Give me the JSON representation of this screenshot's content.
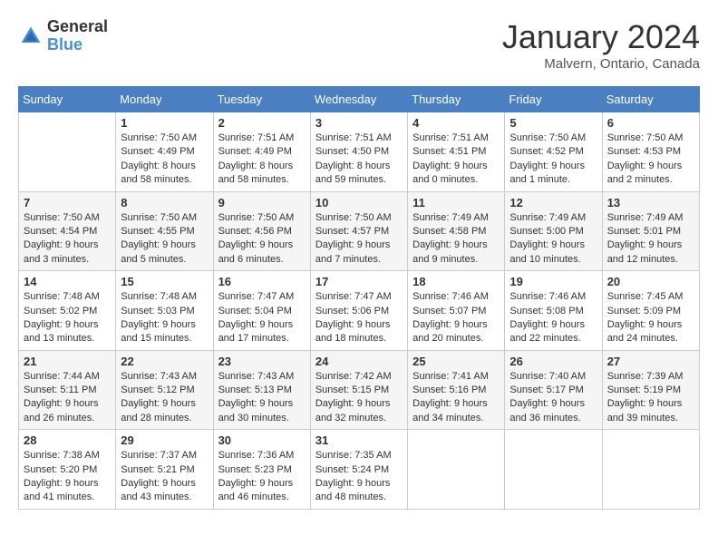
{
  "logo": {
    "general": "General",
    "blue": "Blue"
  },
  "title": "January 2024",
  "location": "Malvern, Ontario, Canada",
  "weekdays": [
    "Sunday",
    "Monday",
    "Tuesday",
    "Wednesday",
    "Thursday",
    "Friday",
    "Saturday"
  ],
  "weeks": [
    [
      {
        "day": "",
        "sunrise": "",
        "sunset": "",
        "daylight": ""
      },
      {
        "day": "1",
        "sunrise": "Sunrise: 7:50 AM",
        "sunset": "Sunset: 4:49 PM",
        "daylight": "Daylight: 8 hours and 58 minutes."
      },
      {
        "day": "2",
        "sunrise": "Sunrise: 7:51 AM",
        "sunset": "Sunset: 4:49 PM",
        "daylight": "Daylight: 8 hours and 58 minutes."
      },
      {
        "day": "3",
        "sunrise": "Sunrise: 7:51 AM",
        "sunset": "Sunset: 4:50 PM",
        "daylight": "Daylight: 8 hours and 59 minutes."
      },
      {
        "day": "4",
        "sunrise": "Sunrise: 7:51 AM",
        "sunset": "Sunset: 4:51 PM",
        "daylight": "Daylight: 9 hours and 0 minutes."
      },
      {
        "day": "5",
        "sunrise": "Sunrise: 7:50 AM",
        "sunset": "Sunset: 4:52 PM",
        "daylight": "Daylight: 9 hours and 1 minute."
      },
      {
        "day": "6",
        "sunrise": "Sunrise: 7:50 AM",
        "sunset": "Sunset: 4:53 PM",
        "daylight": "Daylight: 9 hours and 2 minutes."
      }
    ],
    [
      {
        "day": "7",
        "sunrise": "Sunrise: 7:50 AM",
        "sunset": "Sunset: 4:54 PM",
        "daylight": "Daylight: 9 hours and 3 minutes."
      },
      {
        "day": "8",
        "sunrise": "Sunrise: 7:50 AM",
        "sunset": "Sunset: 4:55 PM",
        "daylight": "Daylight: 9 hours and 5 minutes."
      },
      {
        "day": "9",
        "sunrise": "Sunrise: 7:50 AM",
        "sunset": "Sunset: 4:56 PM",
        "daylight": "Daylight: 9 hours and 6 minutes."
      },
      {
        "day": "10",
        "sunrise": "Sunrise: 7:50 AM",
        "sunset": "Sunset: 4:57 PM",
        "daylight": "Daylight: 9 hours and 7 minutes."
      },
      {
        "day": "11",
        "sunrise": "Sunrise: 7:49 AM",
        "sunset": "Sunset: 4:58 PM",
        "daylight": "Daylight: 9 hours and 9 minutes."
      },
      {
        "day": "12",
        "sunrise": "Sunrise: 7:49 AM",
        "sunset": "Sunset: 5:00 PM",
        "daylight": "Daylight: 9 hours and 10 minutes."
      },
      {
        "day": "13",
        "sunrise": "Sunrise: 7:49 AM",
        "sunset": "Sunset: 5:01 PM",
        "daylight": "Daylight: 9 hours and 12 minutes."
      }
    ],
    [
      {
        "day": "14",
        "sunrise": "Sunrise: 7:48 AM",
        "sunset": "Sunset: 5:02 PM",
        "daylight": "Daylight: 9 hours and 13 minutes."
      },
      {
        "day": "15",
        "sunrise": "Sunrise: 7:48 AM",
        "sunset": "Sunset: 5:03 PM",
        "daylight": "Daylight: 9 hours and 15 minutes."
      },
      {
        "day": "16",
        "sunrise": "Sunrise: 7:47 AM",
        "sunset": "Sunset: 5:04 PM",
        "daylight": "Daylight: 9 hours and 17 minutes."
      },
      {
        "day": "17",
        "sunrise": "Sunrise: 7:47 AM",
        "sunset": "Sunset: 5:06 PM",
        "daylight": "Daylight: 9 hours and 18 minutes."
      },
      {
        "day": "18",
        "sunrise": "Sunrise: 7:46 AM",
        "sunset": "Sunset: 5:07 PM",
        "daylight": "Daylight: 9 hours and 20 minutes."
      },
      {
        "day": "19",
        "sunrise": "Sunrise: 7:46 AM",
        "sunset": "Sunset: 5:08 PM",
        "daylight": "Daylight: 9 hours and 22 minutes."
      },
      {
        "day": "20",
        "sunrise": "Sunrise: 7:45 AM",
        "sunset": "Sunset: 5:09 PM",
        "daylight": "Daylight: 9 hours and 24 minutes."
      }
    ],
    [
      {
        "day": "21",
        "sunrise": "Sunrise: 7:44 AM",
        "sunset": "Sunset: 5:11 PM",
        "daylight": "Daylight: 9 hours and 26 minutes."
      },
      {
        "day": "22",
        "sunrise": "Sunrise: 7:43 AM",
        "sunset": "Sunset: 5:12 PM",
        "daylight": "Daylight: 9 hours and 28 minutes."
      },
      {
        "day": "23",
        "sunrise": "Sunrise: 7:43 AM",
        "sunset": "Sunset: 5:13 PM",
        "daylight": "Daylight: 9 hours and 30 minutes."
      },
      {
        "day": "24",
        "sunrise": "Sunrise: 7:42 AM",
        "sunset": "Sunset: 5:15 PM",
        "daylight": "Daylight: 9 hours and 32 minutes."
      },
      {
        "day": "25",
        "sunrise": "Sunrise: 7:41 AM",
        "sunset": "Sunset: 5:16 PM",
        "daylight": "Daylight: 9 hours and 34 minutes."
      },
      {
        "day": "26",
        "sunrise": "Sunrise: 7:40 AM",
        "sunset": "Sunset: 5:17 PM",
        "daylight": "Daylight: 9 hours and 36 minutes."
      },
      {
        "day": "27",
        "sunrise": "Sunrise: 7:39 AM",
        "sunset": "Sunset: 5:19 PM",
        "daylight": "Daylight: 9 hours and 39 minutes."
      }
    ],
    [
      {
        "day": "28",
        "sunrise": "Sunrise: 7:38 AM",
        "sunset": "Sunset: 5:20 PM",
        "daylight": "Daylight: 9 hours and 41 minutes."
      },
      {
        "day": "29",
        "sunrise": "Sunrise: 7:37 AM",
        "sunset": "Sunset: 5:21 PM",
        "daylight": "Daylight: 9 hours and 43 minutes."
      },
      {
        "day": "30",
        "sunrise": "Sunrise: 7:36 AM",
        "sunset": "Sunset: 5:23 PM",
        "daylight": "Daylight: 9 hours and 46 minutes."
      },
      {
        "day": "31",
        "sunrise": "Sunrise: 7:35 AM",
        "sunset": "Sunset: 5:24 PM",
        "daylight": "Daylight: 9 hours and 48 minutes."
      },
      {
        "day": "",
        "sunrise": "",
        "sunset": "",
        "daylight": ""
      },
      {
        "day": "",
        "sunrise": "",
        "sunset": "",
        "daylight": ""
      },
      {
        "day": "",
        "sunrise": "",
        "sunset": "",
        "daylight": ""
      }
    ]
  ]
}
